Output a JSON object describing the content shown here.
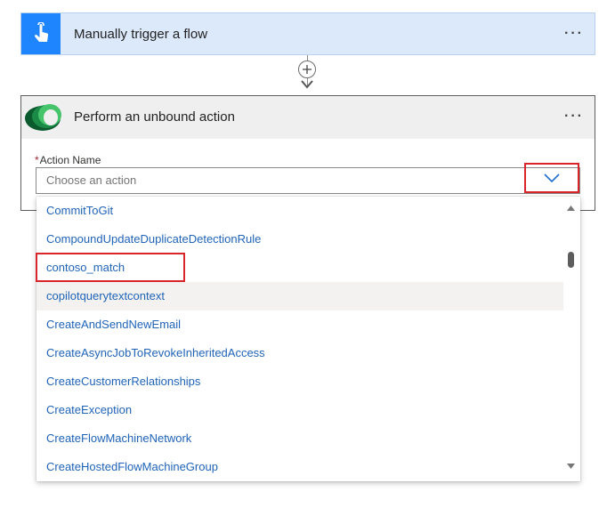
{
  "trigger": {
    "title": "Manually trigger a flow",
    "more_label": "···",
    "icon": "touch-hand-icon",
    "color": "#1f85ff"
  },
  "add_step": {
    "icon": "plus-icon"
  },
  "action": {
    "title": "Perform an unbound action",
    "more_label": "···",
    "icon": "dataverse-logo",
    "field": {
      "required_marker": "*",
      "label": "Action Name",
      "placeholder": "Choose an action",
      "expand_icon": "chevron-down-icon"
    }
  },
  "dropdown": {
    "options": [
      "CommitToGit",
      "CompoundUpdateDuplicateDetectionRule",
      "contoso_match",
      "copilotquerytextcontext",
      "CreateAndSendNewEmail",
      "CreateAsyncJobToRevokeInheritedAccess",
      "CreateCustomerRelationships",
      "CreateException",
      "CreateFlowMachineNetwork",
      "CreateHostedFlowMachineGroup"
    ],
    "hovered_option": "copilotquerytextcontext",
    "highlighted_option": "contoso_match"
  },
  "colors": {
    "highlight": "#d9252a",
    "link": "#2064b8"
  }
}
